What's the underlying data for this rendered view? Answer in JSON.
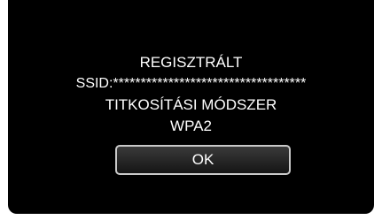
{
  "dialog": {
    "title": "REGISZTRÁLT",
    "ssid_line": "SSID:***********************************",
    "encryption_label": "TITKOSÍTÁSI MÓDSZER",
    "encryption_value": "WPA2",
    "ok_label": "OK"
  },
  "colors": {
    "screen_background": "#000000",
    "text": "#ffffff",
    "button_border": "#c9c9c9"
  }
}
